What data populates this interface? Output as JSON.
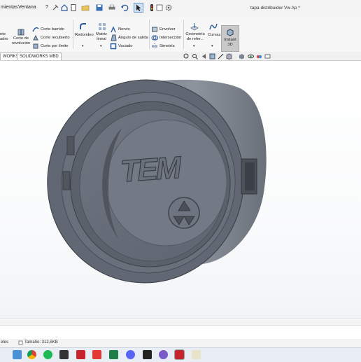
{
  "menu": {
    "items": [
      "mientas",
      "Ventana",
      "?"
    ]
  },
  "document": {
    "title": "tapa distribuidor Vw Ap *"
  },
  "ribbon": {
    "extruded_cut_partial": [
      "nte",
      "adro"
    ],
    "revolved_cut": [
      "Corte de",
      "revolución"
    ],
    "swept_cut": "Corte barrido",
    "lofted_cut": "Corte recubierto",
    "boundary_cut": "Corte por límite",
    "fillet": "Redondeo",
    "linear_pattern": [
      "Matriz",
      "lineal"
    ],
    "rib": "Nervio",
    "draft": "Ángulo de salida",
    "shell": "Vaciado",
    "wrap": "Envolver",
    "intersect": "Intersección",
    "mirror": "Simetría",
    "reference_geometry": [
      "Geometría",
      "de refer..."
    ],
    "curves": "Curvas",
    "instant3d": [
      "Instant",
      "3D"
    ]
  },
  "tabs": [
    "WORKS",
    "SOLIDWORKS MBD"
  ],
  "model": {
    "logo_text": "TEM"
  },
  "status": {
    "left_text": "eles",
    "file_size": "Tamaño: 312,5KB"
  },
  "colors": {
    "ribbon_bg": "#f7f7f7",
    "model_face": "#6e7480",
    "model_dark": "#4d535e",
    "model_light": "#9aa0aa"
  }
}
